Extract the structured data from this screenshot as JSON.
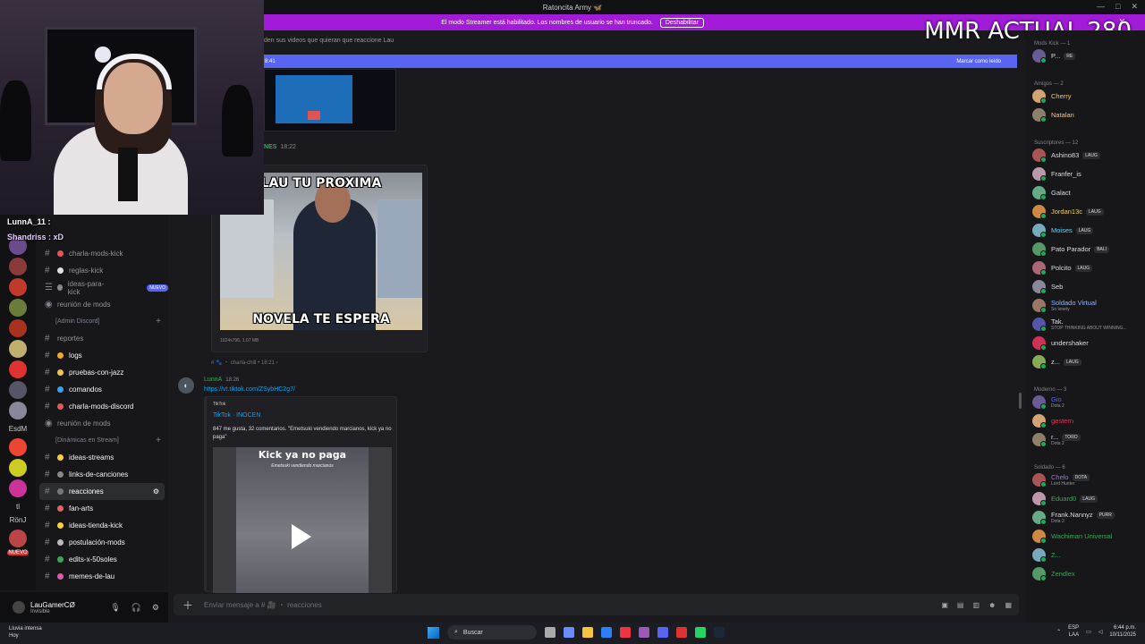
{
  "window": {
    "title": "Ratoncita Army 🦋",
    "controls": [
      "—",
      "□",
      "✕"
    ]
  },
  "streamer_bar": {
    "text": "El modo Streamer está habilitado. Los nombres de usuario se han truncado.",
    "button": "Deshabilitar"
  },
  "overlay": {
    "mmr_text": "MMR ACTUAL 280",
    "chat_lines": [
      "LunnA_11 :",
      "Shandriss : xD"
    ]
  },
  "channels": {
    "items": [
      {
        "label": "charla-mods-kick",
        "type": "hash",
        "color": "#e05a5a",
        "bright": false
      },
      {
        "label": "reglas-kick",
        "type": "hash",
        "color": "#e0e0e0",
        "bright": false
      },
      {
        "label": "ideas-para-kick",
        "type": "forum",
        "color": "#888",
        "bright": false,
        "badge": "NUEVO"
      },
      {
        "label": "reunión de mods",
        "type": "voice",
        "color": "#aaa",
        "bright": false
      }
    ],
    "cat_admin": "[Admin Discord]",
    "admin_items": [
      {
        "label": "reportes",
        "type": "hash",
        "bright": false
      },
      {
        "label": "logs",
        "type": "hash",
        "color": "#f0a732",
        "bright": true
      },
      {
        "label": "pruebas-con-jazz",
        "type": "hash",
        "color": "#f0c34a",
        "bright": true
      },
      {
        "label": "comandos",
        "type": "hash",
        "color": "#3fa0e8",
        "bright": true
      },
      {
        "label": "charla-mods-discord",
        "type": "hash",
        "color": "#e05a5a",
        "bright": true
      },
      {
        "label": "reunión de mods",
        "type": "voice",
        "bright": false
      }
    ],
    "cat_dyn": "[Dinámicas en Stream]",
    "dyn_items": [
      {
        "label": "ideas-streams",
        "type": "hash",
        "color": "#f5d142",
        "bright": true
      },
      {
        "label": "links-de-canciones",
        "type": "hash",
        "color": "#888",
        "bright": true
      },
      {
        "label": "reacciones",
        "type": "hash",
        "color": "#777",
        "bright": true,
        "active": true
      },
      {
        "label": "fan-arts",
        "type": "hash",
        "color": "#e06666",
        "bright": true
      },
      {
        "label": "ideas-tienda-kick",
        "type": "hash",
        "color": "#f5d142",
        "bright": true
      },
      {
        "label": "postulación-mods",
        "type": "hash",
        "color": "#bbb",
        "bright": true
      },
      {
        "label": "edits-x-50soles",
        "type": "hash",
        "color": "#3ba55c",
        "bright": true
      },
      {
        "label": "memes-de-lau",
        "type": "hash",
        "color": "#e05aa5",
        "bright": true
      }
    ]
  },
  "rail_labels": [
    "EsdM",
    "tl",
    "RönJ",
    "NUEVO"
  ],
  "user": {
    "name": "LauGamerCØ",
    "status": "Invisible"
  },
  "main": {
    "top_text": "den sus videos que quieran que reaccione Lau",
    "newbar_time": "8:41",
    "newbar_action": "Marcar como leído",
    "nes_name": "NES",
    "nes_time": "18:22",
    "meme_top": "LAU TU PROXIMA",
    "meme_bottom": "NOVELA TE ESPERA",
    "meme_meta": "1024x796, 1.07 MB",
    "chill_ref": "# 🐾 ・ charla-chill • 18:21 ›",
    "luna_name": "LunnA",
    "luna_time": "18:26",
    "link": "https://vt.tiktok.com/ZSybHC2g7/",
    "tt_source": "TikTok",
    "tt_title": "TikTok · INOCEN",
    "tt_desc": "847 me gusta, 32 comentarios. \"Emetsuki vendiendo marcianos, kick ya no paga\"",
    "tt_caption": "Kick ya no paga",
    "tt_sub": "Emetsuki vendiendo marcianos",
    "composer": "Enviar mensaje a # 🎥 ・ reacciones"
  },
  "members": {
    "groups": [
      {
        "header": "Mods Kick — 1",
        "items": [
          {
            "name": "P...",
            "color": "#dbdee1",
            "tag": "RE"
          }
        ]
      },
      {
        "header": "Amigos — 2",
        "items": [
          {
            "name": "Cherry",
            "color": "#f5c76b"
          },
          {
            "name": "Natalan",
            "color": "#f5c76b"
          }
        ]
      },
      {
        "header": "Suscriptores — 12",
        "items": [
          {
            "name": "Ashino83",
            "color": "#dbdee1",
            "tag": "LAUG"
          },
          {
            "name": "Franfer_is",
            "color": "#dbdee1"
          },
          {
            "name": "Galact",
            "color": "#dbdee1"
          },
          {
            "name": "Jordan13c",
            "color": "#f5d142",
            "tag": "LAUG"
          },
          {
            "name": "Moises",
            "color": "#5fd6ff",
            "tag": "LAUG"
          },
          {
            "name": "Pato Parador",
            "color": "#dbdee1",
            "tag": "BALI"
          },
          {
            "name": "Polcito",
            "color": "#dbdee1",
            "tag": "LAUG"
          },
          {
            "name": "Seb",
            "color": "#dbdee1"
          },
          {
            "name": "Soldado Virtual",
            "color": "#8fb8ff",
            "sub": "So lonely"
          },
          {
            "name": "Tak.",
            "color": "#dbdee1",
            "sub": "STOP THINKING ABOUT WINNING..."
          },
          {
            "name": "undershaker",
            "color": "#dbdee1"
          },
          {
            "name": "z...",
            "color": "#dbdee1",
            "tag": "LAUG"
          }
        ]
      },
      {
        "header": "Moderno — 3",
        "items": [
          {
            "name": "Gio",
            "color": "#5865f2",
            "sub": "Dota 2"
          },
          {
            "name": "gestern",
            "color": "#e0365a"
          },
          {
            "name": "r...",
            "color": "#dbdee1",
            "tag": "TORO",
            "sub": "Dota 2"
          }
        ]
      },
      {
        "header": "Soldado — 6",
        "items": [
          {
            "name": "Chelo",
            "color": "#a36bff",
            "tag": "DOTA",
            "sub": "Lord Hunter"
          },
          {
            "name": "Eduard0",
            "color": "#3ba55c",
            "tag": "LAUG"
          },
          {
            "name": "Frank.Nannyz",
            "color": "#dbdee1",
            "tag": "PURR",
            "sub": "Dota 2"
          },
          {
            "name": "Wachiman Universal",
            "color": "#3ba55c"
          },
          {
            "name": "Z...",
            "color": "#3ba55c"
          },
          {
            "name": "Zendlex",
            "color": "#3ba55c"
          }
        ]
      }
    ]
  },
  "taskbar": {
    "weather_title": "Lluvia intensa",
    "weather_sub": "Hoy",
    "search": "Buscar",
    "lang": "ESP",
    "lang_sub": "LAA",
    "time": "6:44 p.m.",
    "date": "10/11/2025"
  }
}
